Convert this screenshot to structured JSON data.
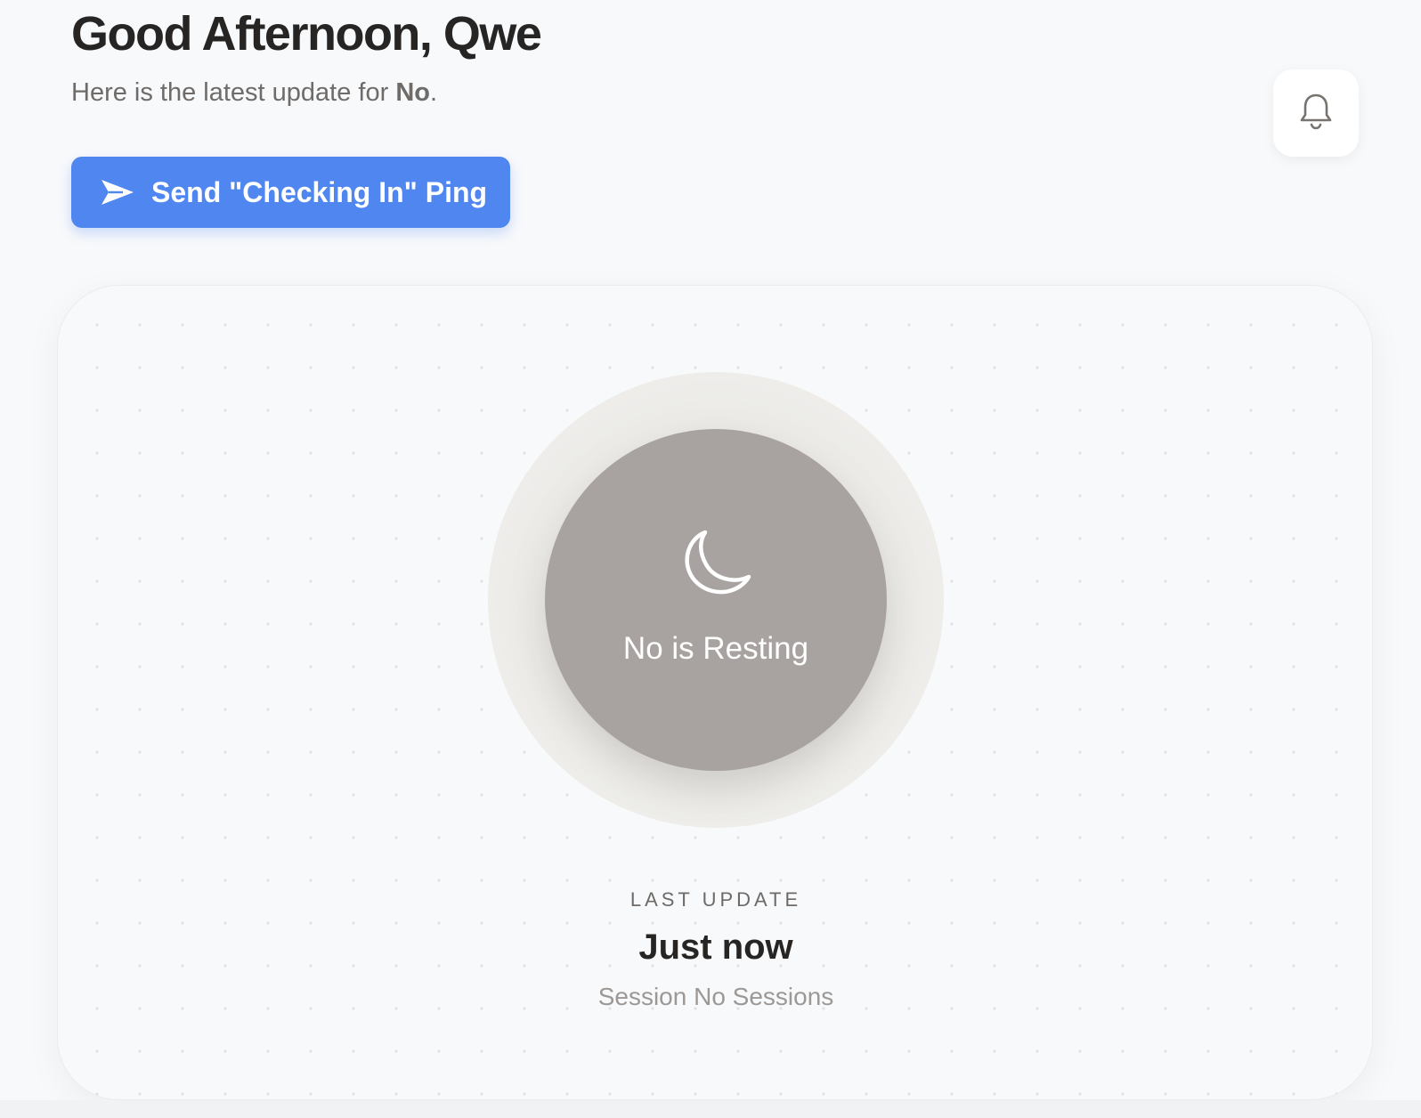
{
  "header": {
    "greeting": "Good Afternoon, Qwe",
    "subtitle_prefix": "Here is the latest update for ",
    "subtitle_name": "No",
    "subtitle_suffix": "."
  },
  "actions": {
    "ping_label": "Send \"Checking In\" Ping",
    "ping_icon": "send-icon",
    "notifications_icon": "bell-icon"
  },
  "status": {
    "icon": "moon-icon",
    "label": "No is Resting",
    "circle_color": "#a8a3a0"
  },
  "last_update": {
    "label": "LAST UPDATE",
    "value": "Just now",
    "session": "Session No Sessions"
  },
  "colors": {
    "accent": "#4f86f0",
    "background": "#f8f9fb"
  }
}
